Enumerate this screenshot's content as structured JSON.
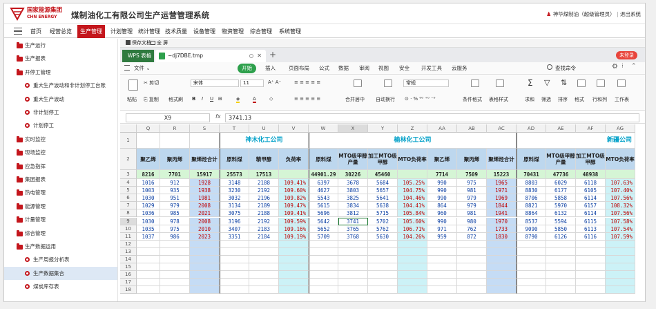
{
  "header": {
    "logo_cn": "国家能源集团",
    "logo_en": "CHN ENERGY",
    "title": "煤制油化工有限公司生产运营管理系统",
    "user": "神华煤制油（超级管理员）",
    "logout": "退出系统",
    "sep": "|"
  },
  "nav": [
    "首页",
    "经营总览",
    "生产管理",
    "计划管理",
    "统计管理",
    "技术质量",
    "设备管理",
    "物资管理",
    "综合管理",
    "系统管理"
  ],
  "sidebar": [
    {
      "label": "生产运行",
      "type": "folder"
    },
    {
      "label": "生产报表",
      "type": "folder"
    },
    {
      "label": "开停工管理",
      "type": "folder"
    },
    {
      "label": "重大生产波动和非计划停工台账",
      "type": "bullet"
    },
    {
      "label": "重大生产波动",
      "type": "bullet"
    },
    {
      "label": "非计划停工",
      "type": "bullet"
    },
    {
      "label": "计划停工",
      "type": "bullet"
    },
    {
      "label": "实时监控",
      "type": "folder"
    },
    {
      "label": "现场监控",
      "type": "folder"
    },
    {
      "label": "应急指挥",
      "type": "folder"
    },
    {
      "label": "集团报表",
      "type": "folder"
    },
    {
      "label": "热电管理",
      "type": "folder"
    },
    {
      "label": "能源管理",
      "type": "folder"
    },
    {
      "label": "计量管理",
      "type": "folder"
    },
    {
      "label": "综合管理",
      "type": "folder"
    },
    {
      "label": "生产数据运用",
      "type": "folder"
    },
    {
      "label": "生产周报分析表",
      "type": "bullet"
    },
    {
      "label": "生产数据集合",
      "type": "bullet"
    },
    {
      "label": "煤炭库存表",
      "type": "bullet"
    }
  ],
  "doc_toolbar": {
    "save": "保存文档",
    "fullscreen": "全 屏"
  },
  "wps": {
    "home": "WPS 表格",
    "tab": "~dj7DBE.tmp",
    "plus": "+",
    "login": "未登录"
  },
  "ribbon_tabs": [
    "文件",
    "开始",
    "插入",
    "页面布局",
    "公式",
    "数据",
    "审阅",
    "视图",
    "安全",
    "开发工具",
    "云服务"
  ],
  "ribbon_search": "查找命令",
  "ribbon": {
    "cut": "剪切",
    "copy": "复制",
    "paste": "粘贴",
    "format_painter": "格式刷",
    "font": "宋体",
    "size": "11",
    "merge": "合并居中",
    "wrap": "自动换行",
    "numfmt": "常规",
    "cond": "条件格式",
    "table_style": "表格样式",
    "sum": "求和",
    "filter": "筛选",
    "sort": "排序",
    "format": "格式",
    "rowcol": "行和列",
    "sheet": "工作表"
  },
  "formula": {
    "ref": "X9",
    "fx": "fx",
    "value": "3741.13"
  },
  "columns": [
    "Q",
    "R",
    "S",
    "T",
    "U",
    "V",
    "W",
    "X",
    "Y",
    "Z",
    "AA",
    "AB",
    "AC",
    "AD",
    "AE",
    "AF",
    "AG"
  ],
  "groups": [
    "神木化工公司",
    "榆林化工公司",
    "新疆公司"
  ],
  "headers": [
    "聚乙烯",
    "聚丙烯",
    "聚烯烃合计",
    "原料煤",
    "精甲醇",
    "负荷率",
    "原料煤",
    "MTO级甲醇产量",
    "加工MTO级甲醇",
    "MTO负荷率",
    "聚乙烯",
    "聚丙烯",
    "聚烯烃合计",
    "原料煤",
    "MTO级甲醇产量",
    "加工MTO级甲醇",
    "MTO负荷率"
  ],
  "row3": [
    "8216",
    "7701",
    "15917",
    "25573",
    "17513",
    "",
    "44901.29",
    "30226",
    "45460",
    "",
    "7714",
    "7509",
    "15223",
    "70431",
    "47736",
    "48938",
    ""
  ],
  "rows": [
    [
      "1016",
      "912",
      "1928",
      "3148",
      "2188",
      "109.41%",
      "6397",
      "3678",
      "5684",
      "105.25%",
      "990",
      "975",
      "1965",
      "8803",
      "6029",
      "6118",
      "107.63%"
    ],
    [
      "1003",
      "935",
      "1938",
      "3230",
      "2192",
      "109.60%",
      "4627",
      "3803",
      "5657",
      "104.75%",
      "990",
      "981",
      "1971",
      "8830",
      "6177",
      "6105",
      "107.40%"
    ],
    [
      "1030",
      "951",
      "1981",
      "3032",
      "2196",
      "109.82%",
      "5543",
      "3825",
      "5641",
      "104.46%",
      "990",
      "979",
      "1969",
      "8706",
      "5858",
      "6114",
      "107.56%"
    ],
    [
      "1029",
      "979",
      "2008",
      "3134",
      "2189",
      "109.47%",
      "5615",
      "3834",
      "5638",
      "104.41%",
      "864",
      "979",
      "1844",
      "8821",
      "5970",
      "6157",
      "108.32%"
    ],
    [
      "1036",
      "985",
      "2021",
      "3075",
      "2188",
      "109.41%",
      "5696",
      "3812",
      "5715",
      "105.84%",
      "960",
      "981",
      "1941",
      "8864",
      "6132",
      "6114",
      "107.56%"
    ],
    [
      "1030",
      "978",
      "2008",
      "3196",
      "2192",
      "109.59%",
      "5642",
      "3741",
      "5702",
      "105.60%",
      "990",
      "980",
      "1970",
      "8537",
      "5594",
      "6115",
      "107.58%"
    ],
    [
      "1035",
      "975",
      "2010",
      "3407",
      "2183",
      "109.16%",
      "5652",
      "3765",
      "5762",
      "106.71%",
      "971",
      "762",
      "1733",
      "9090",
      "5850",
      "6113",
      "107.54%"
    ],
    [
      "1037",
      "986",
      "2023",
      "3351",
      "2184",
      "109.19%",
      "5709",
      "3768",
      "5630",
      "104.26%",
      "959",
      "872",
      "1830",
      "8790",
      "6126",
      "6116",
      "107.59%"
    ]
  ],
  "row_numbers": [
    "1",
    "2",
    "3",
    "4",
    "5",
    "6",
    "7",
    "8",
    "9",
    "10",
    "11",
    "12",
    "13",
    "14",
    "15",
    "16",
    "17",
    "18"
  ],
  "colors": {
    "brand": "#c4161c",
    "wps_green": "#2ea04c",
    "header_blue": "#bdd7ee",
    "col_cyan": "#ccf2f7",
    "total_blue": "#c5dcf5",
    "row3_green": "#d5f5d5",
    "value_blue": "#0b3fa3",
    "value_red": "#c00000",
    "group_cyan": "#00a0c8"
  }
}
